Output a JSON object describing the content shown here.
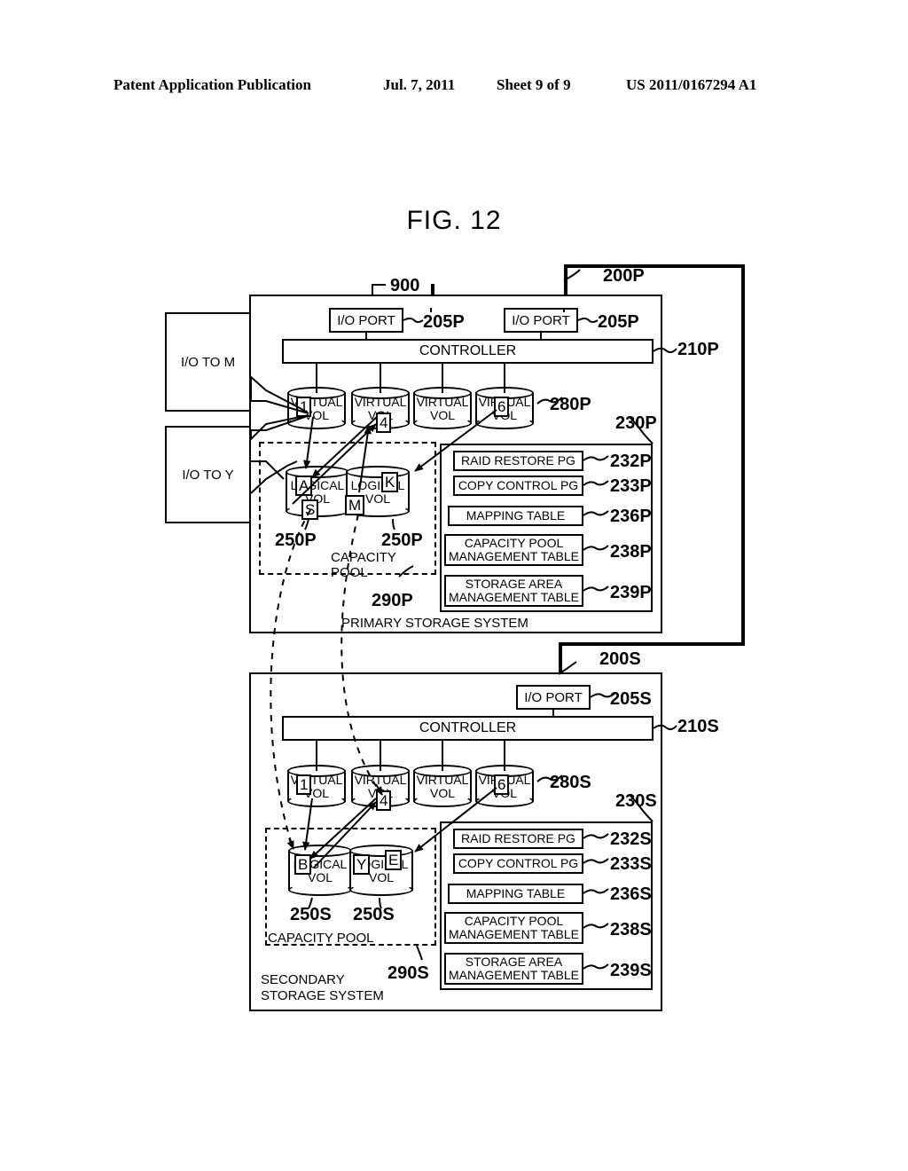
{
  "header": {
    "publication": "Patent Application Publication",
    "date": "Jul. 7, 2011",
    "sheet": "Sheet 9 of 9",
    "number": "US 2011/0167294 A1"
  },
  "figure": {
    "title": "FIG. 12"
  },
  "network": {
    "ref": "900"
  },
  "hosts": [
    {
      "label": "I/O TO M"
    },
    {
      "label": "I/O TO Y"
    }
  ],
  "primary": {
    "system_ref": "200P",
    "system_label": "PRIMARY STORAGE SYSTEM",
    "ports": [
      {
        "label": "I/O PORT",
        "ref": "205P"
      },
      {
        "label": "I/O PORT",
        "ref": "205P"
      }
    ],
    "controller": {
      "label": "CONTROLLER",
      "ref": "210P"
    },
    "virtual_vols_ref": "280P",
    "virtual_vols": [
      {
        "label": "VIRTUAL VOL",
        "line1": "VIRTUAL",
        "line2": "VOL",
        "tag": "1"
      },
      {
        "label": "VIRTUAL VOL",
        "line1": "VIRTUAL",
        "line2": "VOL",
        "tag": "4"
      },
      {
        "label": "VIRTUAL VOL",
        "line1": "VIRTUAL",
        "line2": "VOL",
        "tag": ""
      },
      {
        "label": "VIRTUAL VOL",
        "line1": "VIRTUAL",
        "line2": "VOL",
        "tag": "6"
      }
    ],
    "capacity_pool": {
      "label_line1": "CAPACITY",
      "label_line2": "POOL",
      "ref": "290P"
    },
    "logical_vols": [
      {
        "line1": "LOGICAL",
        "line2": "VOL",
        "ref": "250P",
        "tags": [
          "A",
          "S"
        ]
      },
      {
        "line1": "LOGICAL",
        "line2": "VOL",
        "ref": "250P",
        "tags": [
          "K",
          "M"
        ]
      }
    ],
    "memory_ref": "230P",
    "tables": [
      {
        "label": "RAID RESTORE PG",
        "ref": "232P",
        "lines": [
          "RAID RESTORE PG"
        ]
      },
      {
        "label": "COPY CONTROL PG",
        "ref": "233P",
        "lines": [
          "COPY CONTROL PG"
        ]
      },
      {
        "label": "MAPPING TABLE",
        "ref": "236P",
        "lines": [
          "MAPPING TABLE"
        ]
      },
      {
        "label": "CAPACITY POOL MANAGEMENT TABLE",
        "ref": "238P",
        "lines": [
          "CAPACITY POOL",
          "MANAGEMENT TABLE"
        ]
      },
      {
        "label": "STORAGE AREA MANAGEMENT TABLE",
        "ref": "239P",
        "lines": [
          "STORAGE AREA",
          "MANAGEMENT TABLE"
        ]
      }
    ]
  },
  "secondary": {
    "system_ref": "200S",
    "system_label_line1": "SECONDARY",
    "system_label_line2": "STORAGE SYSTEM",
    "ports": [
      {
        "label": "I/O PORT",
        "ref": "205S"
      }
    ],
    "controller": {
      "label": "CONTROLLER",
      "ref": "210S"
    },
    "virtual_vols_ref": "280S",
    "virtual_vols": [
      {
        "label": "VIRTUAL VOL",
        "line1": "VIRTUAL",
        "line2": "VOL",
        "tag": "1"
      },
      {
        "label": "VIRTUAL VOL",
        "line1": "VIRTUAL",
        "line2": "VOL",
        "tag": "4"
      },
      {
        "label": "VIRTUAL VOL",
        "line1": "VIRTUAL",
        "line2": "VOL",
        "tag": ""
      },
      {
        "label": "VIRTUAL VOL",
        "line1": "VIRTUAL",
        "line2": "VOL",
        "tag": "6"
      }
    ],
    "capacity_pool": {
      "label": "CAPACITY POOL",
      "ref": "290S"
    },
    "logical_vols": [
      {
        "line1": "LOGICAL",
        "line2": "VOL",
        "ref": "250S",
        "tags": [
          "B"
        ]
      },
      {
        "line1": "LOGICAL",
        "line2": "VOL",
        "ref": "250S",
        "tags": [
          "Y",
          "E"
        ]
      }
    ],
    "memory_ref": "230S",
    "tables": [
      {
        "label": "RAID RESTORE PG",
        "ref": "232S",
        "lines": [
          "RAID RESTORE PG"
        ]
      },
      {
        "label": "COPY CONTROL PG",
        "ref": "233S",
        "lines": [
          "COPY CONTROL PG"
        ]
      },
      {
        "label": "MAPPING TABLE",
        "ref": "236S",
        "lines": [
          "MAPPING TABLE"
        ]
      },
      {
        "label": "CAPACITY POOL MANAGEMENT TABLE",
        "ref": "238S",
        "lines": [
          "CAPACITY POOL",
          "MANAGEMENT TABLE"
        ]
      },
      {
        "label": "STORAGE AREA MANAGEMENT TABLE",
        "ref": "239S",
        "lines": [
          "STORAGE AREA",
          "MANAGEMENT TABLE"
        ]
      }
    ]
  }
}
